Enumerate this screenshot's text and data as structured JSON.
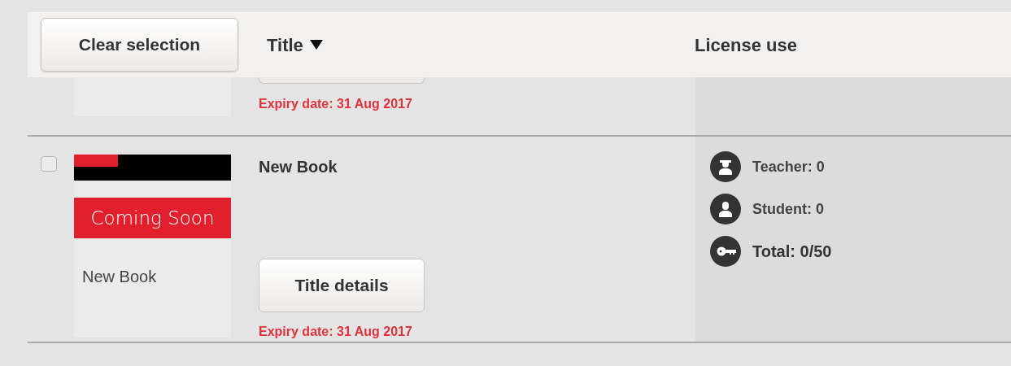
{
  "header": {
    "clear_button": "Clear selection",
    "columns": [
      {
        "label": "Title",
        "sorted": true
      },
      {
        "label": "License use",
        "sorted": false
      }
    ]
  },
  "rows": [
    {
      "cut_off": true,
      "expiry": "Expiry date: 31 Aug 2017"
    },
    {
      "cut_off": false,
      "checked": false,
      "cover": {
        "banner": "Coming Soon",
        "title": "New Book"
      },
      "title": "New Book",
      "details_button": "Title details",
      "expiry": "Expiry date: 31 Aug 2017",
      "license": [
        {
          "kind": "teacher",
          "text": "Teacher: 0"
        },
        {
          "kind": "student",
          "text": "Student: 0"
        },
        {
          "kind": "total",
          "text": "Total: 0/50"
        }
      ]
    }
  ]
}
